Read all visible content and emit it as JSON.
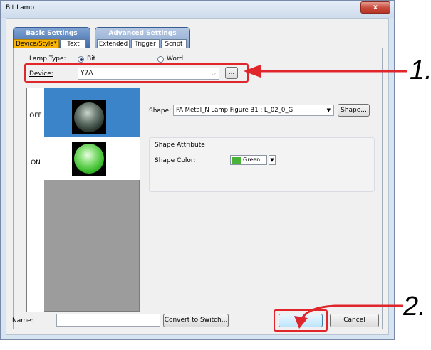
{
  "window": {
    "title": "Bit Lamp",
    "close_label": "x"
  },
  "tab_groups": [
    {
      "label": "Basic Settings",
      "tabs": [
        "Device/Style*",
        "Text"
      ]
    },
    {
      "label": "Advanced Settings",
      "tabs": [
        "Extended",
        "Trigger",
        "Script"
      ]
    }
  ],
  "lamp_type": {
    "label": "Lamp Type:",
    "options": [
      "Bit",
      "Word"
    ],
    "selected": "Bit"
  },
  "device": {
    "label": "Device:",
    "value": "Y7A",
    "browse_label": "..."
  },
  "states": [
    "OFF",
    "ON"
  ],
  "shape": {
    "label": "Shape:",
    "value": "FA Metal_N Lamp Figure B1 : L_02_0_G",
    "button_label": "Shape...",
    "attribute_title": "Shape Attribute",
    "color_label": "Shape Color:",
    "color_value": "Green",
    "color_hex": "#49b238"
  },
  "footer": {
    "name_label": "Name:",
    "name_value": "",
    "convert_label": "Convert to Switch...",
    "ok_label": "OK",
    "cancel_label": "Cancel"
  },
  "annotations": [
    "1.",
    "2."
  ],
  "colors": {
    "highlight": "#e0262b",
    "selected_state": "#3c84c9",
    "active_tab": "#f9b400"
  }
}
